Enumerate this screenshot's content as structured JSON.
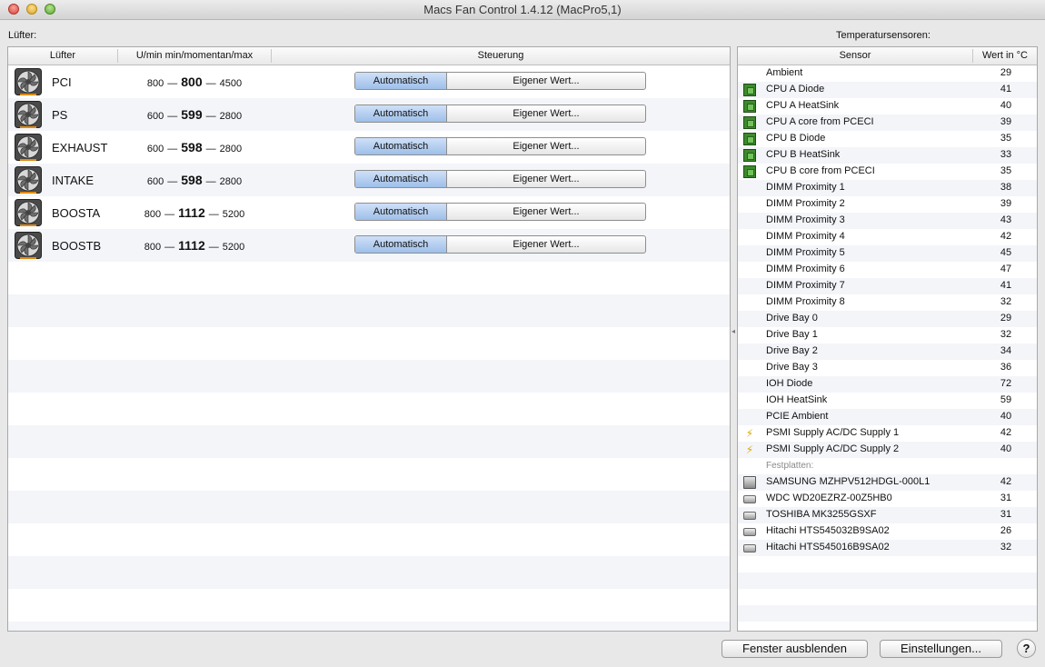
{
  "window": {
    "title": "Macs Fan Control 1.4.12 (MacPro5,1)"
  },
  "fans_label": "Lüfter:",
  "sensors_label": "Temperatursensoren:",
  "fan_table": {
    "headers": {
      "fan": "Lüfter",
      "rpm": "U/min min/momentan/max",
      "control": "Steuerung"
    },
    "rows": [
      {
        "name": "PCI",
        "min": "800",
        "current": "800",
        "max": "4500",
        "auto_label": "Automatisch",
        "custom_label": "Eigener Wert..."
      },
      {
        "name": "PS",
        "min": "600",
        "current": "599",
        "max": "2800",
        "auto_label": "Automatisch",
        "custom_label": "Eigener Wert..."
      },
      {
        "name": "EXHAUST",
        "min": "600",
        "current": "598",
        "max": "2800",
        "auto_label": "Automatisch",
        "custom_label": "Eigener Wert..."
      },
      {
        "name": "INTAKE",
        "min": "600",
        "current": "598",
        "max": "2800",
        "auto_label": "Automatisch",
        "custom_label": "Eigener Wert..."
      },
      {
        "name": "BOOSTA",
        "min": "800",
        "current": "1112",
        "max": "5200",
        "auto_label": "Automatisch",
        "custom_label": "Eigener Wert..."
      },
      {
        "name": "BOOSTB",
        "min": "800",
        "current": "1112",
        "max": "5200",
        "auto_label": "Automatisch",
        "custom_label": "Eigener Wert..."
      }
    ]
  },
  "sensor_table": {
    "headers": {
      "sensor": "Sensor",
      "value": "Wert in °C"
    },
    "rows": [
      {
        "name": "Ambient",
        "value": "29",
        "icon": "none"
      },
      {
        "name": "CPU A Diode",
        "value": "41",
        "icon": "chip"
      },
      {
        "name": "CPU A HeatSink",
        "value": "40",
        "icon": "chip"
      },
      {
        "name": "CPU A core from PCECI",
        "value": "39",
        "icon": "chip"
      },
      {
        "name": "CPU B Diode",
        "value": "35",
        "icon": "chip"
      },
      {
        "name": "CPU B HeatSink",
        "value": "33",
        "icon": "chip"
      },
      {
        "name": "CPU B core from PCECI",
        "value": "35",
        "icon": "chip"
      },
      {
        "name": "DIMM Proximity 1",
        "value": "38",
        "icon": "none"
      },
      {
        "name": "DIMM Proximity 2",
        "value": "39",
        "icon": "none"
      },
      {
        "name": "DIMM Proximity 3",
        "value": "43",
        "icon": "none"
      },
      {
        "name": "DIMM Proximity 4",
        "value": "42",
        "icon": "none"
      },
      {
        "name": "DIMM Proximity 5",
        "value": "45",
        "icon": "none"
      },
      {
        "name": "DIMM Proximity 6",
        "value": "47",
        "icon": "none"
      },
      {
        "name": "DIMM Proximity 7",
        "value": "41",
        "icon": "none"
      },
      {
        "name": "DIMM Proximity 8",
        "value": "32",
        "icon": "none"
      },
      {
        "name": "Drive Bay 0",
        "value": "29",
        "icon": "none"
      },
      {
        "name": "Drive Bay 1",
        "value": "32",
        "icon": "none"
      },
      {
        "name": "Drive Bay 2",
        "value": "34",
        "icon": "none"
      },
      {
        "name": "Drive Bay 3",
        "value": "36",
        "icon": "none"
      },
      {
        "name": "IOH Diode",
        "value": "72",
        "icon": "none"
      },
      {
        "name": "IOH HeatSink",
        "value": "59",
        "icon": "none"
      },
      {
        "name": "PCIE Ambient",
        "value": "40",
        "icon": "none"
      },
      {
        "name": "PSMI Supply AC/DC Supply 1",
        "value": "42",
        "icon": "bolt"
      },
      {
        "name": "PSMI Supply AC/DC Supply 2",
        "value": "40",
        "icon": "bolt"
      }
    ],
    "disks_group_label": "Festplatten:",
    "disks": [
      {
        "name": "SAMSUNG MZHPV512HDGL-000L1",
        "value": "42",
        "icon": "ssd"
      },
      {
        "name": "WDC WD20EZRZ-00Z5HB0",
        "value": "31",
        "icon": "hdd"
      },
      {
        "name": "TOSHIBA MK3255GSXF",
        "value": "31",
        "icon": "hdd"
      },
      {
        "name": "Hitachi HTS545032B9SA02",
        "value": "26",
        "icon": "hdd"
      },
      {
        "name": "Hitachi HTS545016B9SA02",
        "value": "32",
        "icon": "hdd"
      }
    ]
  },
  "buttons": {
    "hide_window": "Fenster ausblenden",
    "settings": "Einstellungen...",
    "help": "?"
  }
}
